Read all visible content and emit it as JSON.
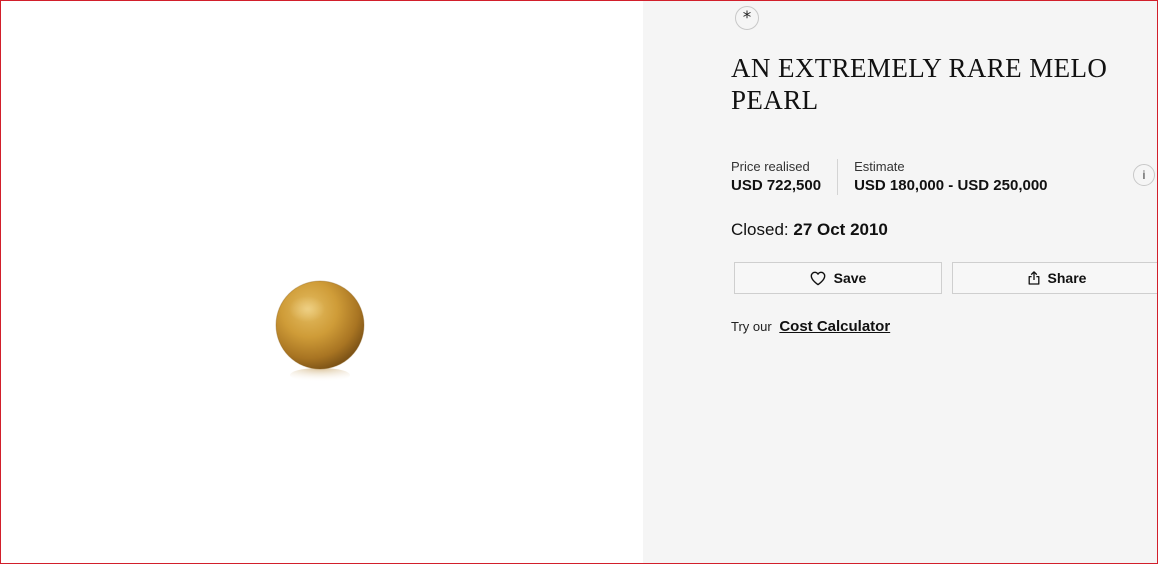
{
  "lot": {
    "title": "AN EXTREMELY RARE MELO PEARL",
    "lot_symbol": "*",
    "info_icon_glyph": "i"
  },
  "pricing": {
    "realised_label": "Price realised",
    "realised_value": "USD 722,500",
    "estimate_label": "Estimate",
    "estimate_value": "USD 180,000 - USD 250,000"
  },
  "status": {
    "closed_label": "Closed:",
    "closed_date": "27 Oct 2010"
  },
  "actions": {
    "save_label": "Save",
    "share_label": "Share"
  },
  "calculator": {
    "prefix": "Try our",
    "link_label": "Cost Calculator"
  },
  "icons": {
    "lot_symbol": "asterisk-icon",
    "info": "info-icon",
    "save": "heart-icon",
    "share": "share-icon"
  },
  "colors": {
    "frame_border": "#d21f2b",
    "panel_background": "#f5f5f5",
    "pearl_base": "#c9952f"
  }
}
